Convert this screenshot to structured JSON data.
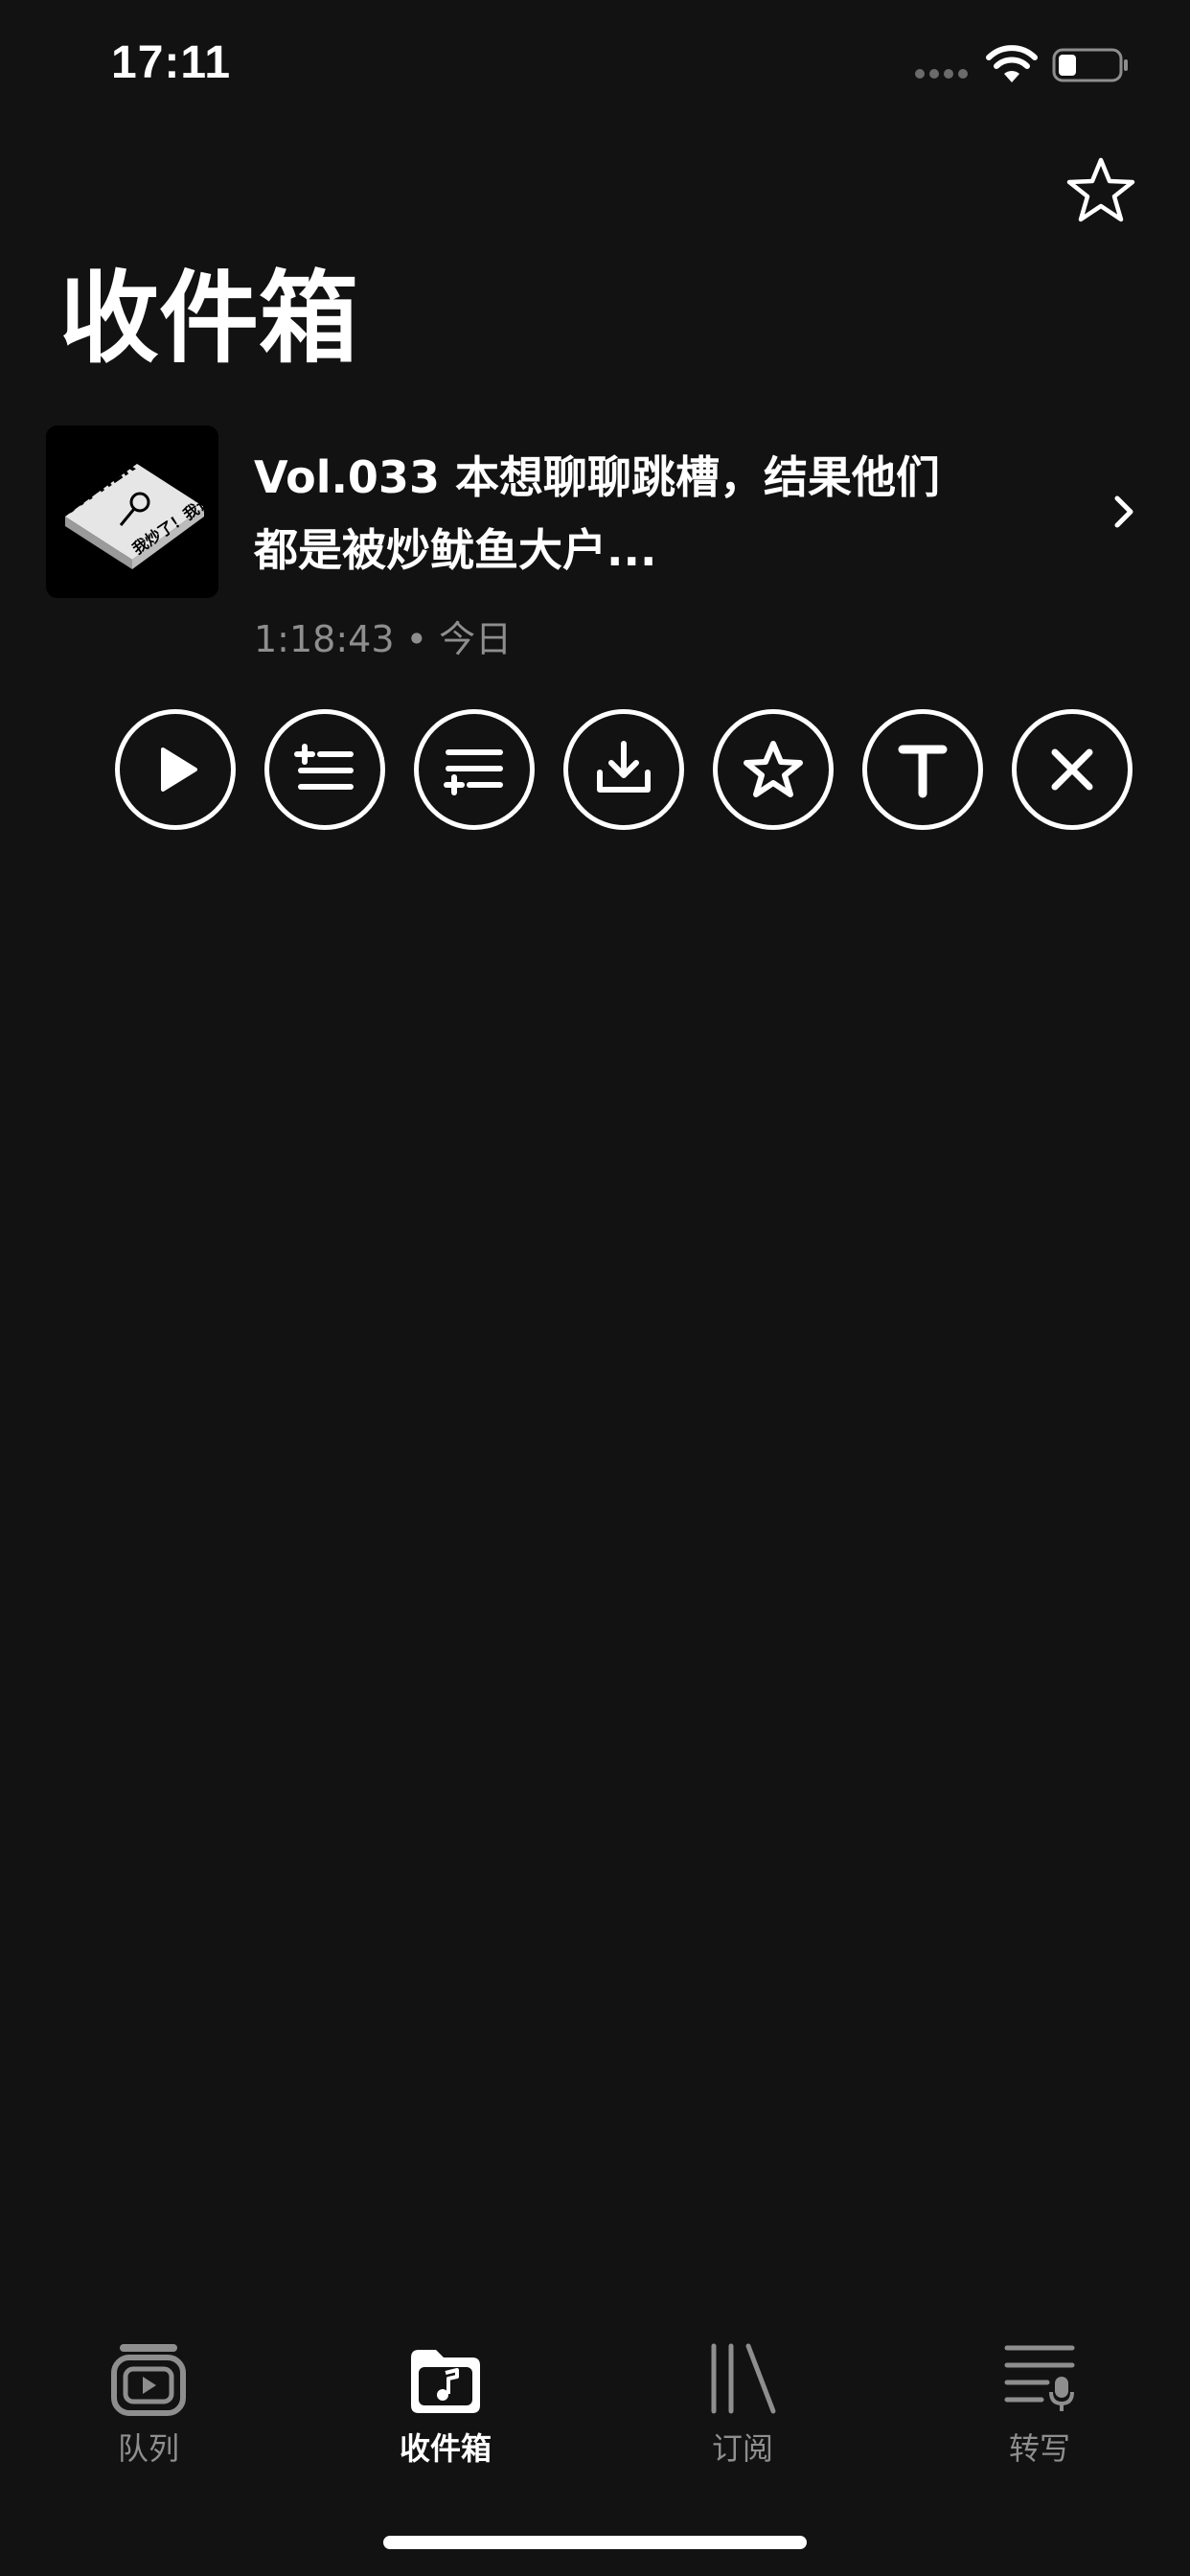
{
  "status_bar": {
    "time": "17:11"
  },
  "header": {
    "title": "收件箱",
    "favorite_icon": "star-outline-icon"
  },
  "episode": {
    "title_line1": "Vol.033 本想聊聊跳槽，结果他们",
    "title_line2": "都是被炒鱿鱼大户...",
    "duration": "1:18:43",
    "separator": "•",
    "date": "今日",
    "artwork": {
      "text_main": "CYPHER",
      "text_sub": "我炒了！我说"
    }
  },
  "actions": [
    {
      "name": "play",
      "icon": "play-icon"
    },
    {
      "name": "play-next",
      "icon": "queue-next-icon"
    },
    {
      "name": "play-last",
      "icon": "queue-last-icon"
    },
    {
      "name": "download",
      "icon": "download-icon"
    },
    {
      "name": "favorite",
      "icon": "star-icon"
    },
    {
      "name": "transcript",
      "icon": "transcript-t-icon"
    },
    {
      "name": "remove",
      "icon": "close-icon"
    }
  ],
  "tabs": [
    {
      "label": "队列",
      "icon": "queue-icon",
      "active": false
    },
    {
      "label": "收件箱",
      "icon": "inbox-folder-icon",
      "active": true
    },
    {
      "label": "订阅",
      "icon": "library-icon",
      "active": false
    },
    {
      "label": "转写",
      "icon": "transcribe-icon",
      "active": false
    }
  ],
  "colors": {
    "background": "#121212",
    "text": "#ffffff",
    "secondary_text": "#8e8e8e"
  }
}
